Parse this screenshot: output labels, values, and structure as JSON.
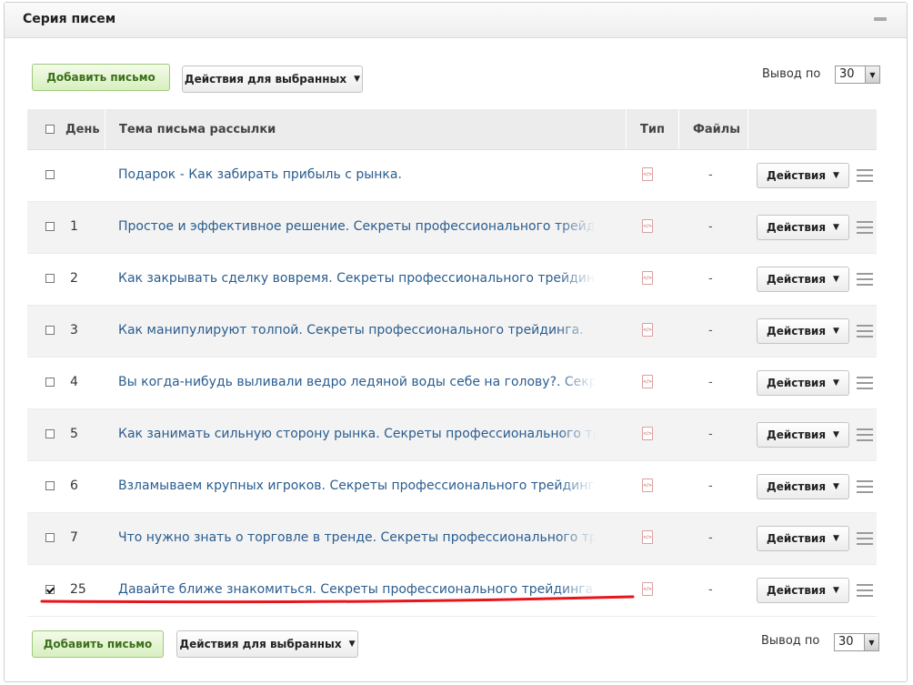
{
  "panel": {
    "title": "Серия писем"
  },
  "toolbar": {
    "add_label": "Добавить письмо",
    "bulk_label": "Действия для выбранных",
    "perpage_label": "Вывод по",
    "perpage_value": "30"
  },
  "table": {
    "headers": {
      "day": "День",
      "subject": "Тема письма рассылки",
      "type": "Тип",
      "files": "Файлы"
    },
    "rows": [
      {
        "checked": false,
        "day": "",
        "subject": "Подарок - Как забирать прибыль с рынка.",
        "type_icon": "html-file-icon",
        "files": "-",
        "action": "Действия"
      },
      {
        "checked": false,
        "day": "1",
        "subject": "Простое и эффективное решение. Секреты профессионального трейдинга.",
        "type_icon": "html-file-icon",
        "files": "-",
        "action": "Действия"
      },
      {
        "checked": false,
        "day": "2",
        "subject": "Как закрывать сделку вовремя. Секреты профессионального трейдинга.",
        "type_icon": "html-file-icon",
        "files": "-",
        "action": "Действия"
      },
      {
        "checked": false,
        "day": "3",
        "subject": "Как манипулируют толпой. Секреты профессионального трейдинга.",
        "type_icon": "html-file-icon",
        "files": "-",
        "action": "Действия"
      },
      {
        "checked": false,
        "day": "4",
        "subject": "Вы когда-нибудь выливали ведро ледяной воды себе на голову?. Секреты профессионального трейдинга.",
        "type_icon": "html-file-icon",
        "files": "-",
        "action": "Действия"
      },
      {
        "checked": false,
        "day": "5",
        "subject": "Как занимать сильную сторону рынка. Секреты профессионального трейдинга.",
        "type_icon": "html-file-icon",
        "files": "-",
        "action": "Действия"
      },
      {
        "checked": false,
        "day": "6",
        "subject": "Взламываем крупных игроков. Секреты профессионального трейдинга.",
        "type_icon": "html-file-icon",
        "files": "-",
        "action": "Действия"
      },
      {
        "checked": false,
        "day": "7",
        "subject": "Что нужно знать о торговле в тренде. Секреты профессионального трейдинга.",
        "type_icon": "html-file-icon",
        "files": "-",
        "action": "Действия"
      },
      {
        "checked": true,
        "day": "25",
        "subject": "Давайте ближе знакомиться. Секреты профессионального трейдинга.",
        "type_icon": "html-file-icon",
        "files": "-",
        "action": "Действия"
      }
    ]
  },
  "colors": {
    "link": "#2a5d8f",
    "annotation": "#e8141c",
    "add_button": "#d8efc0"
  }
}
